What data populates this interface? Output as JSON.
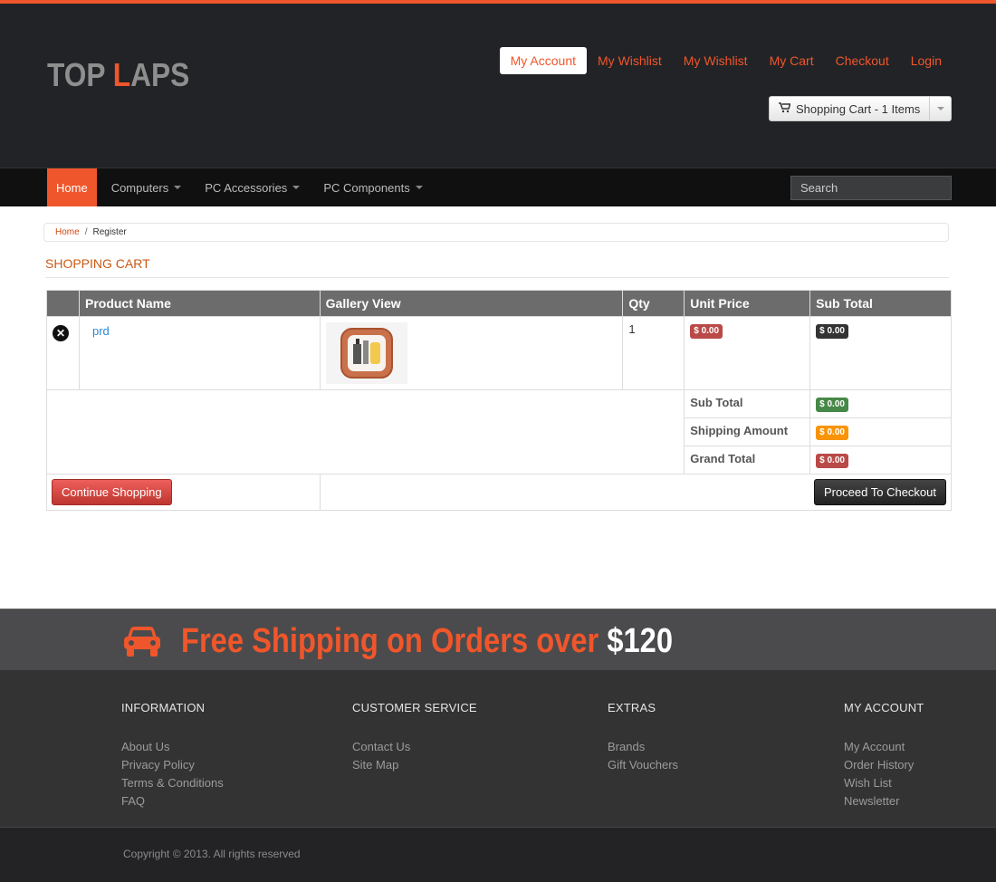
{
  "brand": {
    "logo_part1": "TOP ",
    "logo_accent": "L",
    "logo_part2": "APS"
  },
  "toplinks": [
    {
      "label": "My Account",
      "active": true
    },
    {
      "label": "My Wishlist"
    },
    {
      "label": "My Wishlist"
    },
    {
      "label": "My Cart"
    },
    {
      "label": "Checkout"
    },
    {
      "label": "Login"
    }
  ],
  "cart_button": {
    "label": "Shopping Cart - 1 Items",
    "icon": "cart-icon"
  },
  "nav": {
    "items": [
      {
        "label": "Home",
        "active": true
      },
      {
        "label": "Computers",
        "dropdown": true
      },
      {
        "label": "PC Accessories",
        "dropdown": true
      },
      {
        "label": "PC Components",
        "dropdown": true
      }
    ],
    "search_placeholder": "Search"
  },
  "breadcrumb": {
    "home": "Home",
    "separator": "/",
    "current": "Register"
  },
  "page_title": "SHOPPING CART",
  "table": {
    "headers": [
      "",
      "Product Name",
      "Gallery View",
      "Qty",
      "Unit Price",
      "Sub Total"
    ],
    "rows": [
      {
        "product": "prd",
        "qty": "1",
        "unit_price": "$ 0.00",
        "sub_total": "$ 0.00"
      }
    ],
    "summary": [
      {
        "label": "Sub Total",
        "value": "$ 0.00",
        "color": "#468847"
      },
      {
        "label": "Shipping Amount",
        "value": "$ 0.00",
        "color": "#f89406"
      },
      {
        "label": "Grand Total",
        "value": "$ 0.00",
        "color": "#b94a48"
      }
    ],
    "continue_label": "Continue Shopping",
    "checkout_label": "Proceed To Checkout"
  },
  "promo": {
    "text": "Free Shipping on Orders over ",
    "amount": "$120",
    "icon": "car-icon"
  },
  "footer": {
    "columns": [
      {
        "title": "INFORMATION",
        "links": [
          "About Us",
          "Privacy Policy",
          "Terms & Conditions",
          "FAQ"
        ]
      },
      {
        "title": "CUSTOMER SERVICE",
        "links": [
          "Contact Us",
          "Site Map"
        ]
      },
      {
        "title": "EXTRAS",
        "links": [
          "Brands",
          "Gift Vouchers"
        ]
      },
      {
        "title": "MY ACCOUNT",
        "links": [
          "My Account",
          "Order History",
          "Wish List",
          "Newsletter"
        ]
      }
    ],
    "copyright": "Copyright © 2013. All rights reserved"
  },
  "colors": {
    "accent": "#f0562b",
    "header_bg": "#222326",
    "nav_bg": "#101011",
    "footer_bg": "#333334"
  }
}
